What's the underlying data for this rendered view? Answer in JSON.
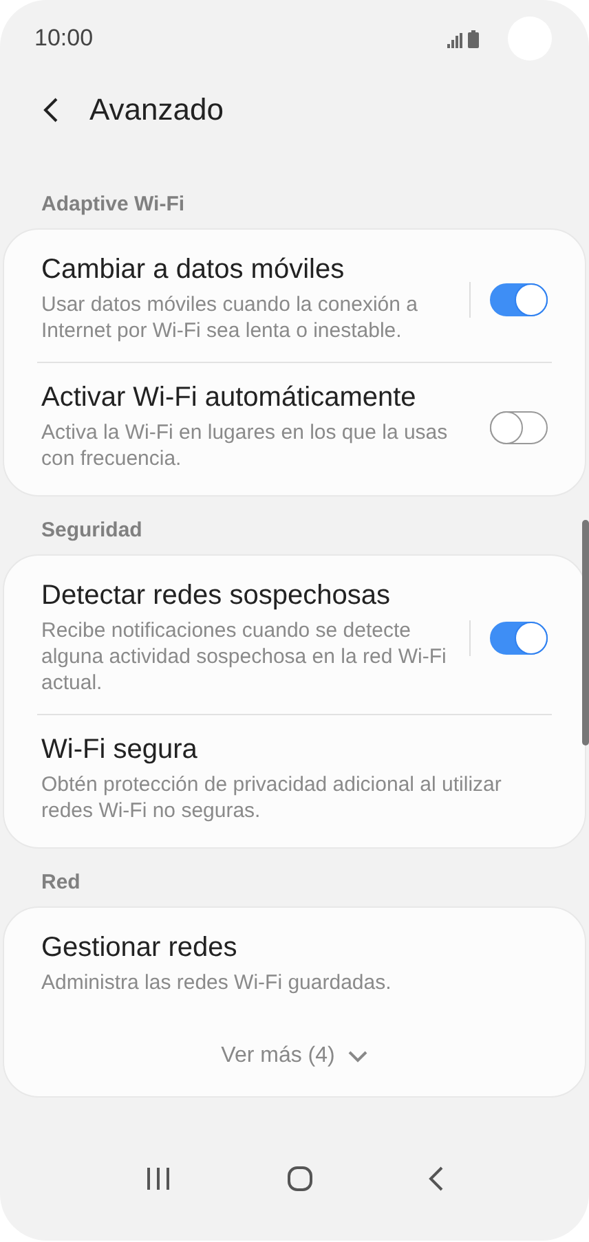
{
  "status_bar": {
    "time": "10:00"
  },
  "header": {
    "title": "Avanzado"
  },
  "sections": [
    {
      "title": "Adaptive Wi-Fi",
      "items": [
        {
          "kind": "toggle",
          "title": "Cambiar a datos móviles",
          "summary": "Usar datos móviles cuando la conexión a Internet por Wi-Fi sea lenta o inestable.",
          "on": true,
          "split": true
        },
        {
          "kind": "toggle",
          "title": "Activar Wi-Fi automáticamente",
          "summary": "Activa la Wi-Fi en lugares en los que la usas con frecuencia.",
          "on": false,
          "split": false
        }
      ]
    },
    {
      "title": "Seguridad",
      "items": [
        {
          "kind": "toggle",
          "title": "Detectar redes sospechosas",
          "summary": "Recibe notificaciones cuando se detecte alguna actividad sospechosa en la red Wi-Fi actual.",
          "on": true,
          "split": true
        },
        {
          "kind": "plain",
          "title": "Wi-Fi segura",
          "summary": "Obtén protección de privacidad adicional al utilizar redes Wi-Fi no seguras."
        }
      ]
    },
    {
      "title": "Red",
      "items": [
        {
          "kind": "plain",
          "title": "Gestionar redes",
          "summary": "Administra las redes Wi-Fi guardadas."
        }
      ],
      "more": "Ver más (4)"
    }
  ]
}
